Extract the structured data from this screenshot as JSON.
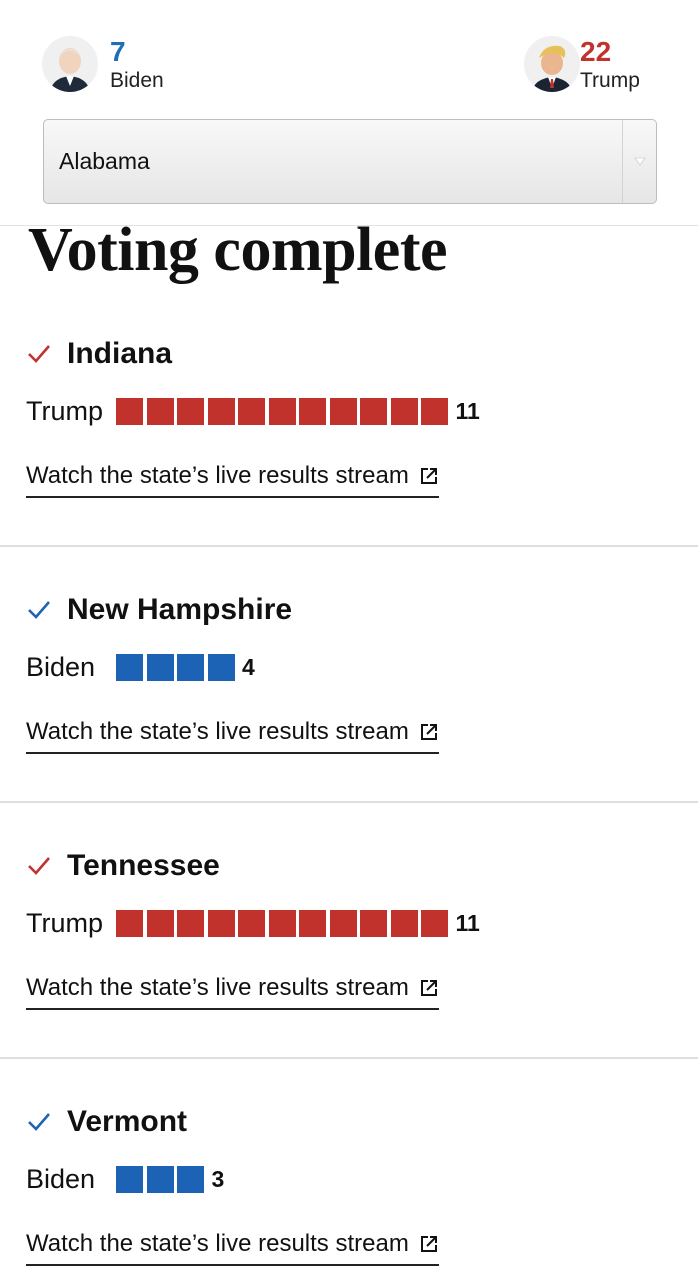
{
  "scoreboard": {
    "biden": {
      "count": "7",
      "name": "Biden",
      "color": "#1f6db5"
    },
    "trump": {
      "count": "22",
      "name": "Trump",
      "color": "#c2322c"
    }
  },
  "state_select": {
    "selected": "Alabama"
  },
  "section_title": "Voting complete",
  "states": [
    {
      "name": "Indiana",
      "winner": "Trump",
      "party_color": "#c2322c",
      "delegates": "11",
      "stream_label": "Watch the state’s live results stream"
    },
    {
      "name": "New Hampshire",
      "winner": "Biden",
      "party_color": "#1d63b5",
      "delegates": "4",
      "stream_label": "Watch the state’s live results stream"
    },
    {
      "name": "Tennessee",
      "winner": "Trump",
      "party_color": "#c2322c",
      "delegates": "11",
      "stream_label": "Watch the state’s live results stream"
    },
    {
      "name": "Vermont",
      "winner": "Biden",
      "party_color": "#1d63b5",
      "delegates": "3",
      "stream_label": "Watch the state’s live results stream"
    }
  ],
  "icons": {
    "check": "check-icon",
    "external_link": "external-link-icon",
    "dropdown": "chevron-down-icon"
  }
}
